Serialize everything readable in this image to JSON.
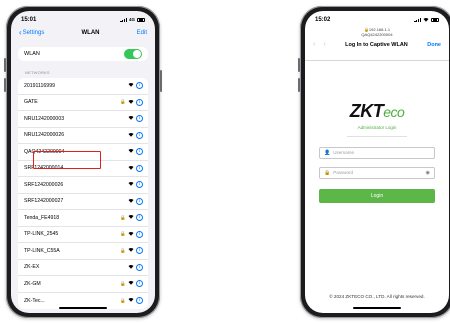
{
  "left_phone": {
    "status": {
      "time": "15:01",
      "network": "4G"
    },
    "nav": {
      "back_label": "Settings",
      "title": "WLAN",
      "edit_label": "Edit"
    },
    "wlan_toggle": {
      "label": "WLAN",
      "enabled": true
    },
    "networks_header": "NETWORKS",
    "networks": [
      {
        "name": "20191116999",
        "locked": false
      },
      {
        "name": "GATE",
        "locked": true
      },
      {
        "name": "NRU1242000003",
        "locked": false
      },
      {
        "name": "NRU1242000026",
        "locked": false,
        "highlighted": true
      },
      {
        "name": "QAQ4242200004",
        "locked": false
      },
      {
        "name": "SRF1242000014",
        "locked": false
      },
      {
        "name": "SRF1242000026",
        "locked": false
      },
      {
        "name": "SRF1242000027",
        "locked": false
      },
      {
        "name": "Tenda_FE4918",
        "locked": true
      },
      {
        "name": "TP-LINK_2545",
        "locked": true
      },
      {
        "name": "TP-LINK_C55A",
        "locked": true
      },
      {
        "name": "ZK-EX",
        "locked": false
      },
      {
        "name": "ZK-GM",
        "locked": true
      },
      {
        "name": "ZK-Tec...",
        "locked": true
      }
    ],
    "highlight_color": "#e02020"
  },
  "right_phone": {
    "status": {
      "time": "15:02"
    },
    "url_host": "192.168.1.1",
    "url_ssid": "QAQ4242200004",
    "title": "Log In to Captive WLAN",
    "done_label": "Done",
    "logo": {
      "main": "ZKT",
      "accent": "eco",
      "accent_color": "#4caf3e"
    },
    "admin_login": "Administrator Login",
    "username_placeholder": "Username",
    "password_placeholder": "Password",
    "login_label": "Login",
    "login_color": "#5cb648",
    "footer": "© 2024 ZKTECO CO., LTD. All rights reserved."
  }
}
